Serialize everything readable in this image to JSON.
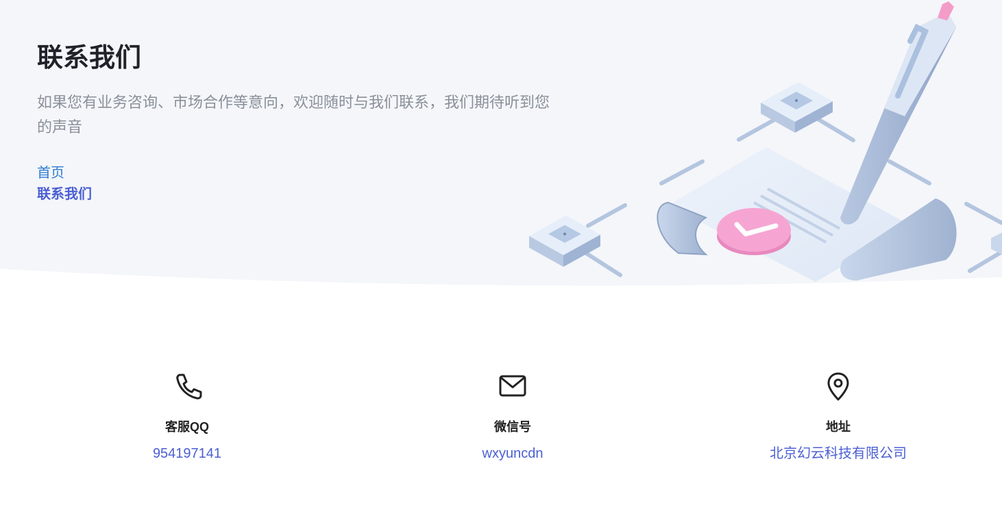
{
  "header": {
    "title": "联系我们",
    "subtitle": "如果您有业务咨询、市场合作等意向，欢迎随时与我们联系，我们期待听到您的声音"
  },
  "breadcrumb": {
    "home": "首页",
    "current": "联系我们"
  },
  "contacts": [
    {
      "icon": "phone-icon",
      "label": "客服QQ",
      "value": "954197141"
    },
    {
      "icon": "mail-icon",
      "label": "微信号",
      "value": "wxyuncdn"
    },
    {
      "icon": "location-pin-icon",
      "label": "地址",
      "value": "北京幻云科技有限公司"
    }
  ],
  "colors": {
    "hero_background": "#f4f6fa",
    "accent": "#4b5fd3",
    "link": "#2b7bd1",
    "title": "#1f2329",
    "subtitle": "#8a9099"
  }
}
